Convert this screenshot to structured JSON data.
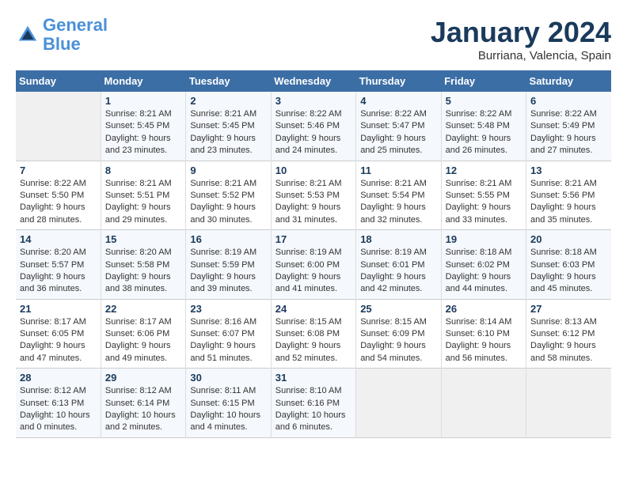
{
  "header": {
    "logo_line1": "General",
    "logo_line2": "Blue",
    "month": "January 2024",
    "location": "Burriana, Valencia, Spain"
  },
  "weekdays": [
    "Sunday",
    "Monday",
    "Tuesday",
    "Wednesday",
    "Thursday",
    "Friday",
    "Saturday"
  ],
  "weeks": [
    [
      {
        "day": "",
        "content": ""
      },
      {
        "day": "1",
        "content": "Sunrise: 8:21 AM\nSunset: 5:45 PM\nDaylight: 9 hours\nand 23 minutes."
      },
      {
        "day": "2",
        "content": "Sunrise: 8:21 AM\nSunset: 5:45 PM\nDaylight: 9 hours\nand 23 minutes."
      },
      {
        "day": "3",
        "content": "Sunrise: 8:22 AM\nSunset: 5:46 PM\nDaylight: 9 hours\nand 24 minutes."
      },
      {
        "day": "4",
        "content": "Sunrise: 8:22 AM\nSunset: 5:47 PM\nDaylight: 9 hours\nand 25 minutes."
      },
      {
        "day": "5",
        "content": "Sunrise: 8:22 AM\nSunset: 5:48 PM\nDaylight: 9 hours\nand 26 minutes."
      },
      {
        "day": "6",
        "content": "Sunrise: 8:22 AM\nSunset: 5:49 PM\nDaylight: 9 hours\nand 27 minutes."
      }
    ],
    [
      {
        "day": "7",
        "content": "Sunrise: 8:22 AM\nSunset: 5:50 PM\nDaylight: 9 hours\nand 28 minutes."
      },
      {
        "day": "8",
        "content": "Sunrise: 8:21 AM\nSunset: 5:51 PM\nDaylight: 9 hours\nand 29 minutes."
      },
      {
        "day": "9",
        "content": "Sunrise: 8:21 AM\nSunset: 5:52 PM\nDaylight: 9 hours\nand 30 minutes."
      },
      {
        "day": "10",
        "content": "Sunrise: 8:21 AM\nSunset: 5:53 PM\nDaylight: 9 hours\nand 31 minutes."
      },
      {
        "day": "11",
        "content": "Sunrise: 8:21 AM\nSunset: 5:54 PM\nDaylight: 9 hours\nand 32 minutes."
      },
      {
        "day": "12",
        "content": "Sunrise: 8:21 AM\nSunset: 5:55 PM\nDaylight: 9 hours\nand 33 minutes."
      },
      {
        "day": "13",
        "content": "Sunrise: 8:21 AM\nSunset: 5:56 PM\nDaylight: 9 hours\nand 35 minutes."
      }
    ],
    [
      {
        "day": "14",
        "content": "Sunrise: 8:20 AM\nSunset: 5:57 PM\nDaylight: 9 hours\nand 36 minutes."
      },
      {
        "day": "15",
        "content": "Sunrise: 8:20 AM\nSunset: 5:58 PM\nDaylight: 9 hours\nand 38 minutes."
      },
      {
        "day": "16",
        "content": "Sunrise: 8:19 AM\nSunset: 5:59 PM\nDaylight: 9 hours\nand 39 minutes."
      },
      {
        "day": "17",
        "content": "Sunrise: 8:19 AM\nSunset: 6:00 PM\nDaylight: 9 hours\nand 41 minutes."
      },
      {
        "day": "18",
        "content": "Sunrise: 8:19 AM\nSunset: 6:01 PM\nDaylight: 9 hours\nand 42 minutes."
      },
      {
        "day": "19",
        "content": "Sunrise: 8:18 AM\nSunset: 6:02 PM\nDaylight: 9 hours\nand 44 minutes."
      },
      {
        "day": "20",
        "content": "Sunrise: 8:18 AM\nSunset: 6:03 PM\nDaylight: 9 hours\nand 45 minutes."
      }
    ],
    [
      {
        "day": "21",
        "content": "Sunrise: 8:17 AM\nSunset: 6:05 PM\nDaylight: 9 hours\nand 47 minutes."
      },
      {
        "day": "22",
        "content": "Sunrise: 8:17 AM\nSunset: 6:06 PM\nDaylight: 9 hours\nand 49 minutes."
      },
      {
        "day": "23",
        "content": "Sunrise: 8:16 AM\nSunset: 6:07 PM\nDaylight: 9 hours\nand 51 minutes."
      },
      {
        "day": "24",
        "content": "Sunrise: 8:15 AM\nSunset: 6:08 PM\nDaylight: 9 hours\nand 52 minutes."
      },
      {
        "day": "25",
        "content": "Sunrise: 8:15 AM\nSunset: 6:09 PM\nDaylight: 9 hours\nand 54 minutes."
      },
      {
        "day": "26",
        "content": "Sunrise: 8:14 AM\nSunset: 6:10 PM\nDaylight: 9 hours\nand 56 minutes."
      },
      {
        "day": "27",
        "content": "Sunrise: 8:13 AM\nSunset: 6:12 PM\nDaylight: 9 hours\nand 58 minutes."
      }
    ],
    [
      {
        "day": "28",
        "content": "Sunrise: 8:12 AM\nSunset: 6:13 PM\nDaylight: 10 hours\nand 0 minutes."
      },
      {
        "day": "29",
        "content": "Sunrise: 8:12 AM\nSunset: 6:14 PM\nDaylight: 10 hours\nand 2 minutes."
      },
      {
        "day": "30",
        "content": "Sunrise: 8:11 AM\nSunset: 6:15 PM\nDaylight: 10 hours\nand 4 minutes."
      },
      {
        "day": "31",
        "content": "Sunrise: 8:10 AM\nSunset: 6:16 PM\nDaylight: 10 hours\nand 6 minutes."
      },
      {
        "day": "",
        "content": ""
      },
      {
        "day": "",
        "content": ""
      },
      {
        "day": "",
        "content": ""
      }
    ]
  ]
}
